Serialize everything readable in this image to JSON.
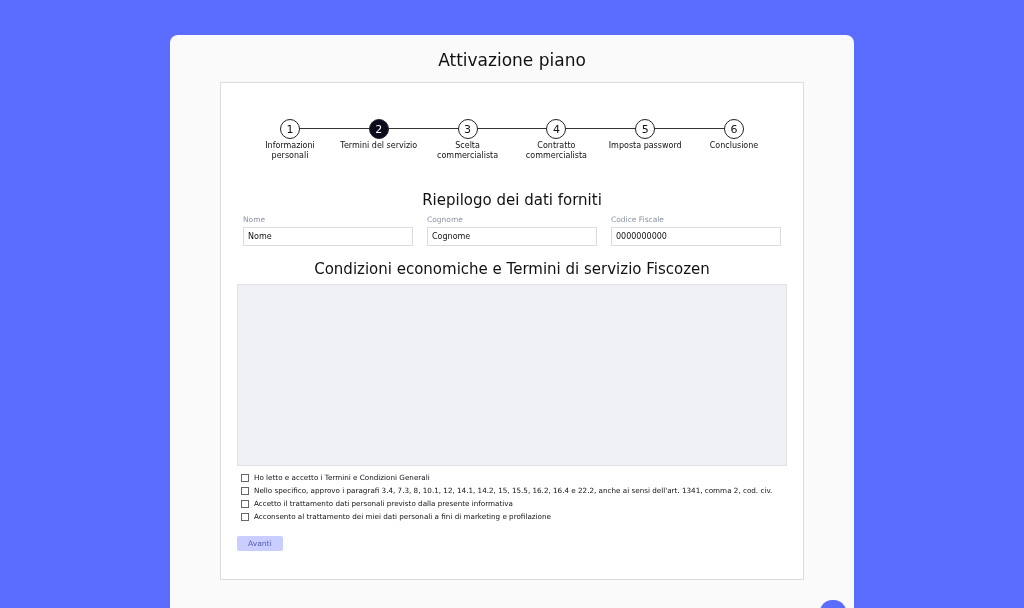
{
  "title": "Attivazione piano",
  "steps": [
    {
      "number": "1",
      "label": "Informazioni personali",
      "selected": false
    },
    {
      "number": "2",
      "label": "Termini del servizio",
      "selected": true
    },
    {
      "number": "3",
      "label": "Scelta commercialista",
      "selected": false
    },
    {
      "number": "4",
      "label": "Contratto commercialista",
      "selected": false
    },
    {
      "number": "5",
      "label": "Imposta password",
      "selected": false
    },
    {
      "number": "6",
      "label": "Conclusione",
      "selected": false
    }
  ],
  "summary": {
    "title": "Riepilogo dei dati forniti",
    "fields": [
      {
        "label": "Nome",
        "value": "Nome"
      },
      {
        "label": "Cognome",
        "value": "Cognome"
      },
      {
        "label": "Codice Fiscale",
        "value": "0000000000"
      }
    ]
  },
  "terms": {
    "title": "Condizioni economiche e Termini di servizio Fiscozen"
  },
  "checkboxes": [
    {
      "label": "Ho letto e accetto i Termini e Condizioni Generali",
      "checked": false
    },
    {
      "label": "Nello specifico, approvo i paragrafi 3.4, 7.3, 8, 10.1, 12, 14.1, 14.2, 15, 15.5, 16.2, 16.4 e 22.2, anche ai sensi dell'art. 1341, comma 2, cod. civ.",
      "checked": false
    },
    {
      "label": "Accetto il trattamento dati personali previsto dalla presente informativa",
      "checked": false
    },
    {
      "label": "Acconsento al trattamento dei miei dati personali a fini di marketing e profilazione",
      "checked": false
    }
  ],
  "next_button": {
    "label": "Avanti",
    "disabled": true
  }
}
